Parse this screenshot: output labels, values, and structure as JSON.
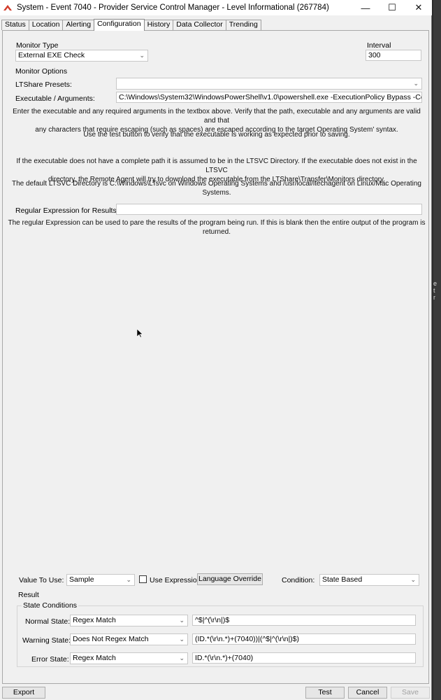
{
  "window": {
    "title": "System - Event 7040 - Provider Service Control Manager - Level Informational (267784)",
    "controls": {
      "minimize": "—",
      "maximize": "☐",
      "close": "✕"
    }
  },
  "tabs": [
    {
      "label": "Status"
    },
    {
      "label": "Location"
    },
    {
      "label": "Alerting"
    },
    {
      "label": "Configuration"
    },
    {
      "label": "History"
    },
    {
      "label": "Data Collector"
    },
    {
      "label": "Trending"
    }
  ],
  "monitor": {
    "type_label": "Monitor Type",
    "type_value": "External EXE Check",
    "interval_label": "Interval",
    "interval_value": "300",
    "options_label": "Monitor Options",
    "presets_label": "LTShare Presets:",
    "presets_value": "",
    "exe_label": "Executable / Arguments:",
    "exe_value": "C:\\Windows\\System32\\WindowsPowerShell\\v1.0\\powershell.exe -ExecutionPolicy Bypass -Command \"mkdir -P",
    "info1_line1": "Enter the executable and any required arguments in the textbox above. Verify that the path, executable and any arguments are valid and that",
    "info1_line2": "any characters that require escaping (such as spaces) are escaped according to the target Operating System' syntax.",
    "info2": "Use the test button to verify that the executable is working as expected prior to saving.",
    "info3_line1": "If the executable does not have a complete path it is assumed to be in the LTSVC Directory. If the executable does not exist in the LTSVC",
    "info3_line2": "directory, the Remote Agent will try to download the executable from the LTShare\\Transfer\\Monitors directory.",
    "info4": "The default LTSVC Directory is C:\\Windows\\LTsvc on Windows Operating Systems and /usr/local/ltechagent on Linux/Mac Operating Systems.",
    "regex_label": "Regular Expression for Results:",
    "regex_value": "",
    "regex_info": "The regular Expression can be used to pare the results of the program being run. If this is blank then the entire output of the program is returned."
  },
  "bottom": {
    "value_to_use_label": "Value To Use:",
    "value_to_use": "Sample",
    "use_expression_label": "Use Expression",
    "use_expression_checked": false,
    "language_override": "Language Override",
    "condition_label": "Condition:",
    "condition_value": "State Based",
    "result_label": "Result",
    "state_conditions_label": "State Conditions",
    "normal_label": "Normal State:",
    "normal_op": "Regex Match",
    "normal_value": "^$|^(\\r\\n|)$",
    "warning_label": "Warning State:",
    "warning_op": "Does Not Regex Match",
    "warning_value": "(ID.*(\\r\\n.*)+(7040))|(^$|^(\\r\\n|)$)",
    "error_label": "Error State:",
    "error_op": "Regex Match",
    "error_value": "ID.*(\\r\\n.*)+(7040)"
  },
  "buttons": {
    "export": "Export",
    "test": "Test",
    "cancel": "Cancel",
    "save": "Save"
  },
  "edge_text": "e\nt\nr"
}
